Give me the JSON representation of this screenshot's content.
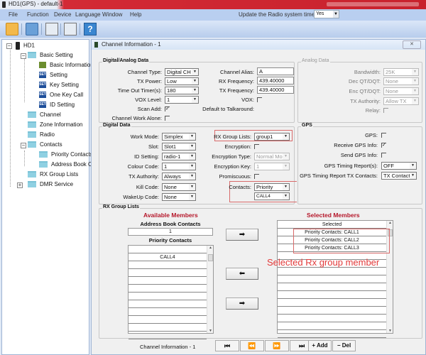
{
  "window": {
    "title": "HD1(GPS)  -  default-1"
  },
  "menu": {
    "items": [
      "File",
      "Function",
      "Device",
      "Language",
      "Window",
      "Help"
    ],
    "update_time_label": "Update the Radio system time",
    "update_time_value": "Yes"
  },
  "toolbar": {
    "icons": [
      "open-icon",
      "save-icon",
      "read-radio-icon",
      "write-radio-icon",
      "help-icon"
    ],
    "help_glyph": "?"
  },
  "tree": {
    "root": "HD1",
    "basic_setting": "Basic Setting",
    "basic_children": [
      "Basic Information",
      "Setting",
      "Key Setting",
      "One Key Call",
      "ID Setting"
    ],
    "set_glyph": "SET",
    "channel": "Channel",
    "zone": "Zone Information",
    "radio": "Radio",
    "contacts": "Contacts",
    "contacts_children": [
      "Priority Contacts",
      "Address Book Co"
    ],
    "rx_group_lists": "RX Group Lists",
    "dmr_service": "DMR Service",
    "collapse_glyph": "−",
    "expand_glyph": "+"
  },
  "child": {
    "title": "Channel Information - 1",
    "close_glyph": "✕",
    "digital_analog": {
      "legend": "Digital/Analog Data",
      "channel_type": {
        "label": "Channel Type:",
        "value": "Digital CH"
      },
      "tx_power": {
        "label": "TX Power:",
        "value": "Low"
      },
      "timeout": {
        "label": "Time Out Timer(s):",
        "value": "180"
      },
      "vox_level": {
        "label": "VOX Level:",
        "value": "1"
      },
      "scan_add": {
        "label": "Scan Add:",
        "checked": true
      },
      "work_alone": {
        "label": "Channel Work Alone:",
        "checked": false
      },
      "alias": {
        "label": "Channel Alias:",
        "value": "A"
      },
      "rx_freq": {
        "label": "RX Frequency:",
        "value": "439.40000"
      },
      "tx_freq": {
        "label": "TX Frequency:",
        "value": "439.40000"
      },
      "vox": {
        "label": "VOX:",
        "checked": false
      },
      "talkaround": {
        "label": "Default to Talkaround:"
      }
    },
    "analog": {
      "legend": "Analog Data",
      "bandwidth": {
        "label": "Bandwidth:",
        "value": "25K"
      },
      "dec": {
        "label": "Dec QT/DQT:",
        "value": "None"
      },
      "enc": {
        "label": "Enc QT/DQT:",
        "value": "None"
      },
      "tx_authority": {
        "label": "TX Authority:",
        "value": "Allow TX"
      },
      "relay": {
        "label": "Relay:",
        "checked": false
      }
    },
    "digital": {
      "legend": "Digital Data",
      "work_mode": {
        "label": "Work Mode:",
        "value": "Simplex"
      },
      "slot": {
        "label": "Slot:",
        "value": "Slot1"
      },
      "id_setting": {
        "label": "ID Setting:",
        "value": "radio-1"
      },
      "colour_code": {
        "label": "Colour Code:",
        "value": "1"
      },
      "tx_authority": {
        "label": "TX Authority:",
        "value": "Always"
      },
      "kill_code": {
        "label": "Kill Code:",
        "value": "None"
      },
      "wakeup_code": {
        "label": "WakeUp Code:",
        "value": "None"
      },
      "rx_group": {
        "label": "RX Group Lists:",
        "value": "group1"
      },
      "encryption": {
        "label": "Encryption:",
        "checked": false
      },
      "enc_type": {
        "label": "Encryption Type:",
        "value": "Normal Moc"
      },
      "enc_key": {
        "label": "Encryption Key:",
        "value": "1"
      },
      "promiscuous": {
        "label": "Promiscuous:",
        "checked": false
      },
      "contacts": {
        "label": "Contacts:",
        "value": "Priority",
        "value2": "CALL4"
      }
    },
    "gps": {
      "legend": "GPS",
      "gps": {
        "label": "GPS:",
        "checked": false
      },
      "receive": {
        "label": "Receive GPS Info:",
        "checked": true
      },
      "send": {
        "label": "Send GPS Info:",
        "checked": false
      },
      "timing": {
        "label": "GPS Timing Report(s):",
        "value": "OFF"
      },
      "timing_tx": {
        "label": "GPS Timing Report TX Contacts:",
        "value": "TX Contact"
      }
    },
    "rx_group_lists": {
      "legend": "RX Group Lists",
      "available_title": "Available Members",
      "address_book_header": "Address Book Contacts",
      "address_book_value": "1",
      "priority_header": "Priority Contacts",
      "priority_rows": [
        "",
        "CALL4",
        "",
        "",
        "",
        "",
        "",
        "",
        "",
        "",
        "",
        ""
      ],
      "selected_title": "Selected Members",
      "selected_header": "Selected",
      "selected_rows": [
        "Priority Contacts: CALL1",
        "Priority Contacts: CALL2",
        "Priority Contacts: CALL3",
        "",
        "",
        "",
        "",
        "",
        "",
        "",
        "",
        "",
        "",
        ""
      ],
      "add_arrow": "➡",
      "remove_arrow": "⬅",
      "add_arrow2": "➡",
      "annotation": "Selected Rx group member"
    },
    "footer": {
      "label": "Channel Information - 1",
      "first": "⏮",
      "prev": "⏪",
      "next": "⏩",
      "last": "⏭",
      "add": "+ Add",
      "del": "− Del"
    }
  }
}
